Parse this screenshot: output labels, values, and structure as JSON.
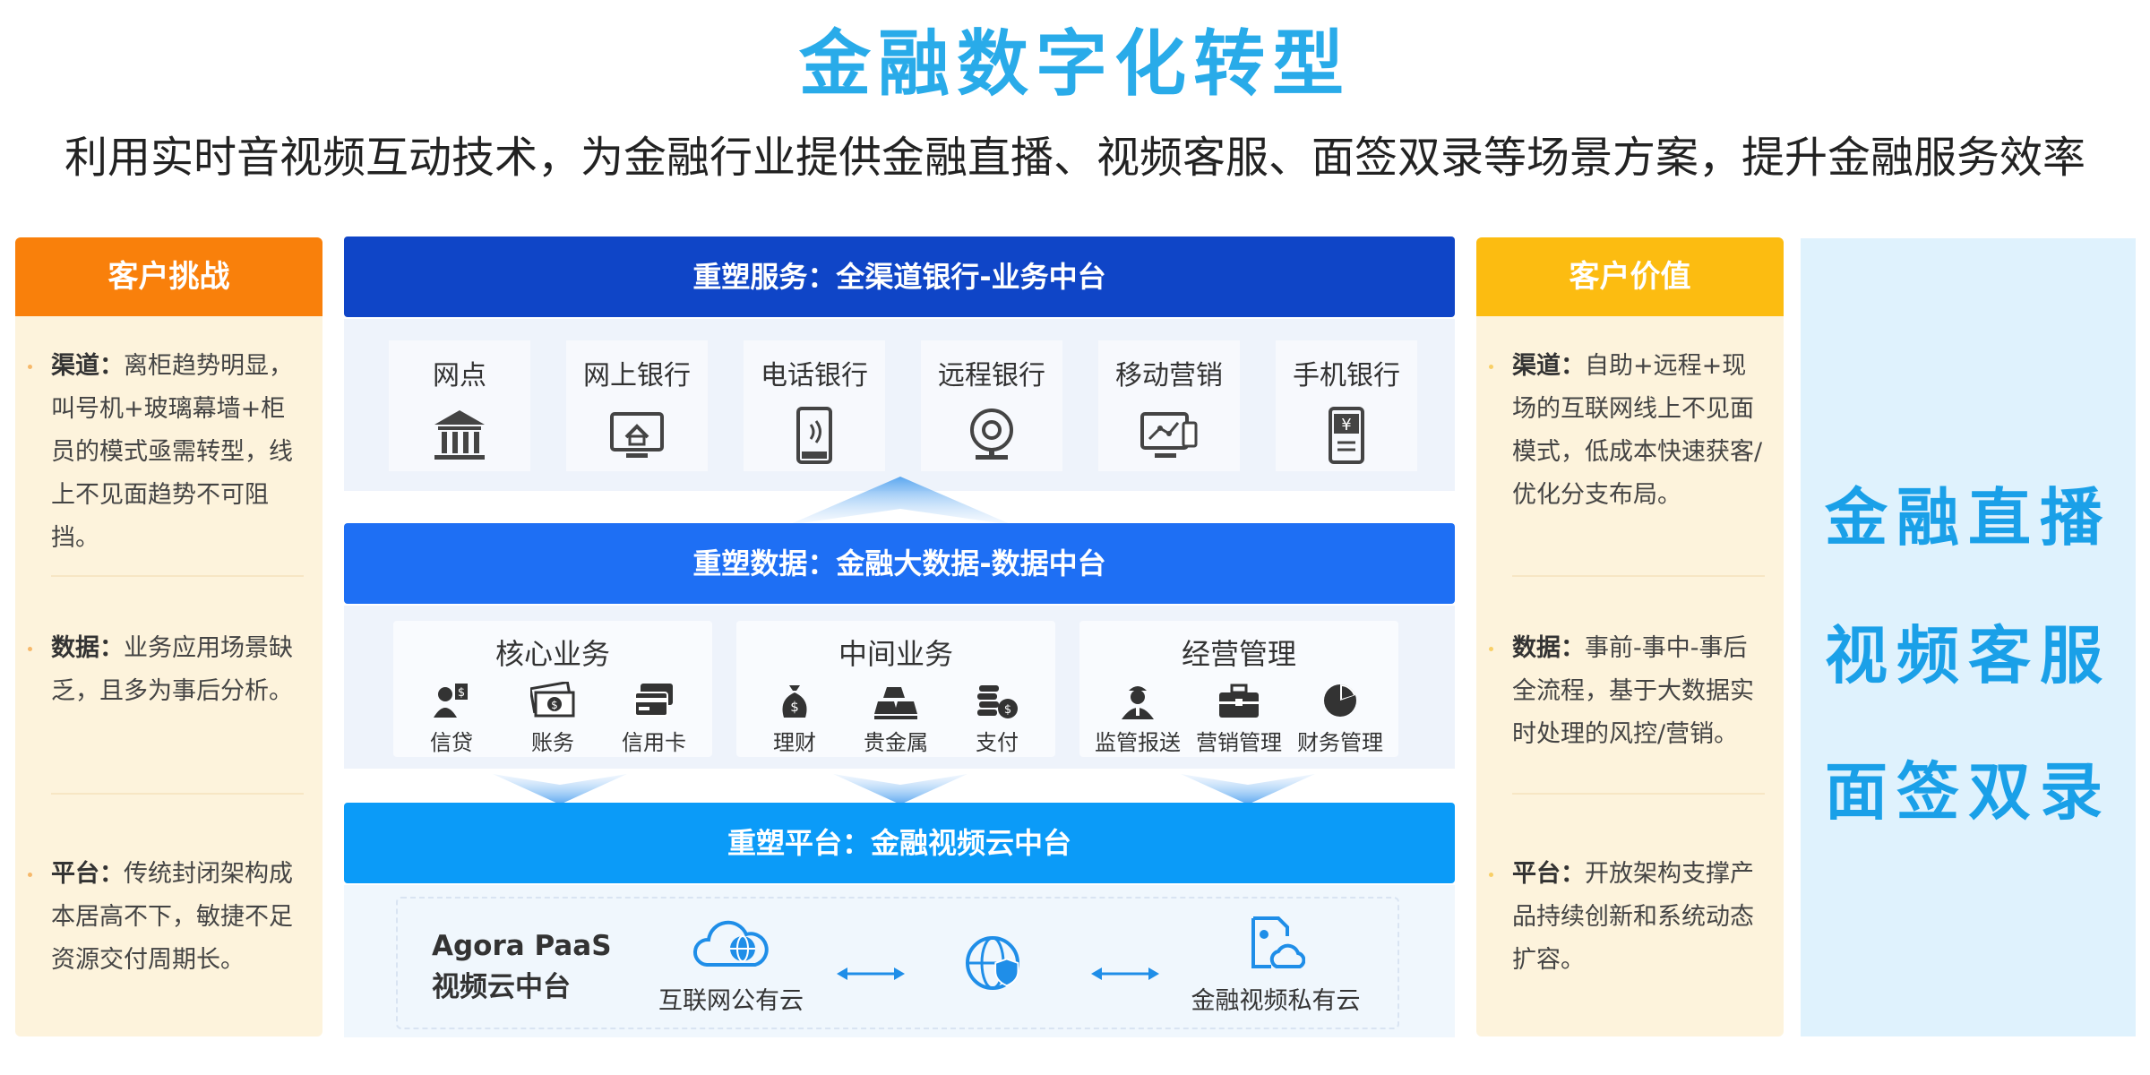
{
  "header": {
    "title": "金融数字化转型",
    "subtitle": "利用实时音视频互动技术，为金融行业提供金融直播、视频客服、面签双录等场景方案，提升金融服务效率"
  },
  "left": {
    "heading": "客户挑战",
    "items": [
      {
        "key": "渠道：",
        "text": "离柜趋势明显，叫号机+玻璃幕墙+柜员的模式亟需转型，线上不见面趋势不可阻挡。"
      },
      {
        "key": "数据：",
        "text": "业务应用场景缺乏，且多为事后分析。"
      },
      {
        "key": "平台：",
        "text": "传统封闭架构成本居高不下，敏捷不足资源交付周期长。"
      }
    ]
  },
  "right": {
    "heading": "客户价值",
    "items": [
      {
        "key": "渠道：",
        "text": "自助+远程+现场的互联网线上不见面模式，低成本快速获客/优化分支布局。"
      },
      {
        "key": "数据：",
        "text": "事前-事中-事后全流程，基于大数据实时处理的风控/营销。"
      },
      {
        "key": "平台：",
        "text": "开放架构支撑产品持续创新和系统动态扩容。"
      }
    ]
  },
  "scenes": [
    "金融直播",
    "视频客服",
    "面签双录"
  ],
  "service": {
    "band": "重塑服务：全渠道银行-业务中台",
    "channels": [
      {
        "label": "网点",
        "icon": "bank-icon"
      },
      {
        "label": "网上银行",
        "icon": "monitor-home-icon"
      },
      {
        "label": "电话银行",
        "icon": "phone-signal-icon"
      },
      {
        "label": "远程银行",
        "icon": "webcam-icon"
      },
      {
        "label": "移动营销",
        "icon": "screen-chart-icon"
      },
      {
        "label": "手机银行",
        "icon": "phone-yen-icon"
      }
    ]
  },
  "data": {
    "band": "重塑数据：金融大数据-数据中台",
    "groups": [
      {
        "title": "核心业务",
        "items": [
          {
            "label": "信贷",
            "icon": "loan-icon"
          },
          {
            "label": "账务",
            "icon": "cash-icon"
          },
          {
            "label": "信用卡",
            "icon": "credit-card-icon"
          }
        ]
      },
      {
        "title": "中间业务",
        "items": [
          {
            "label": "理财",
            "icon": "money-bag-icon"
          },
          {
            "label": "贵金属",
            "icon": "gold-bars-icon"
          },
          {
            "label": "支付",
            "icon": "coins-icon"
          }
        ]
      },
      {
        "title": "经营管理",
        "items": [
          {
            "label": "监管报送",
            "icon": "inspector-icon"
          },
          {
            "label": "营销管理",
            "icon": "briefcase-icon"
          },
          {
            "label": "财务管理",
            "icon": "pie-chart-icon"
          }
        ]
      }
    ]
  },
  "platform": {
    "band": "重塑平台：金融视频云中台",
    "brand_line1": "Agora PaaS",
    "brand_line2": "视频云中台",
    "public_cloud": "互联网公有云",
    "private_cloud": "金融视频私有云"
  },
  "colors": {
    "title": "#29abe9",
    "challenge": "#f9800b",
    "value": "#fcbc11",
    "band1": "#0f45c7",
    "band2": "#1e6ff4",
    "band3": "#0b9bf8",
    "scene": "#1aa0e8"
  }
}
